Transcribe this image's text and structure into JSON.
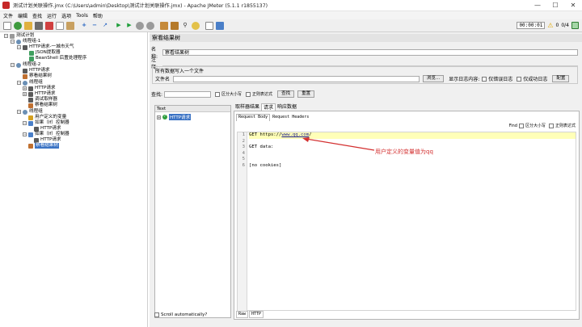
{
  "window": {
    "title": "测试计划关联操作.jmx (C:\\Users\\admin\\Desktop\\测试计划关联操作.jmx) - Apache JMeter (5.1.1 r1855137)",
    "controls": [
      "—",
      "☐",
      "✕"
    ]
  },
  "menu": [
    "文件",
    "编辑",
    "查找",
    "运行",
    "选项",
    "Tools",
    "帮助"
  ],
  "toolbar": {
    "timer": "00:00:01",
    "warn_count": "0",
    "threads": "0/4"
  },
  "tree": [
    {
      "label": "测试计划",
      "exp": "−"
    },
    {
      "label": "线程组-1",
      "exp": "−"
    },
    {
      "label": "HTTP请求-一城市天气",
      "exp": "−"
    },
    {
      "label": "JSON提取器",
      "exp": ""
    },
    {
      "label": "BeanShell 后置处理程序",
      "exp": ""
    },
    {
      "label": "线程组-2",
      "exp": "−"
    },
    {
      "label": "HTTP请求",
      "exp": ""
    },
    {
      "label": "察看结果树",
      "exp": ""
    },
    {
      "label": "线程组",
      "exp": "−"
    },
    {
      "label": "HTTP请求",
      "exp": ""
    },
    {
      "label": "HTTP请求",
      "exp": ""
    },
    {
      "label": "调试取样器",
      "exp": ""
    },
    {
      "label": "察看结果树",
      "exp": ""
    },
    {
      "label": "线程组",
      "exp": "−"
    },
    {
      "label": "用户定义的变量",
      "exp": ""
    },
    {
      "label": "如果（If）控制器",
      "exp": "−"
    },
    {
      "label": "HTTP请求",
      "exp": ""
    },
    {
      "label": "如果（If）控制器",
      "exp": "−"
    },
    {
      "label": "HTTP请求",
      "exp": ""
    },
    {
      "label": "察看结果树",
      "exp": "",
      "selected": true
    }
  ],
  "panel": {
    "title": "察看结果树",
    "name_label": "名称:",
    "name_value": "察看结果树",
    "comment_label": "注释:",
    "all_data_label": "所有数据写入一个文件",
    "filename_label": "文件名",
    "browse_btn": "浏览...",
    "log_label": "显示日志内容:",
    "errors_only": "仅错误日志",
    "success_only": "仅成功日志",
    "configure_btn": "配置",
    "search_label": "查找:",
    "case_sensitive": "区分大小写",
    "regex": "正则表达式",
    "find_btn": "查找",
    "reset_btn": "重置"
  },
  "results": {
    "header": "Text",
    "item": "HTTP请求",
    "scroll_auto": "Scroll automatically?"
  },
  "view": {
    "tabs": [
      "取样器结果",
      "请求",
      "响应数据"
    ],
    "active_tab": 1,
    "subtabs": [
      "Request Body",
      "Request Headers"
    ],
    "find_label": "Find",
    "find_case": "区分大小写",
    "find_regex": "正则表达式",
    "code_lines": [
      {
        "n": "1",
        "pre": "GET https://",
        "url": "www.qq.com",
        "post": "/"
      },
      {
        "n": "2",
        "pre": "",
        "url": "",
        "post": ""
      },
      {
        "n": "3",
        "pre": "GET data:",
        "url": "",
        "post": ""
      },
      {
        "n": "4",
        "pre": "",
        "url": "",
        "post": ""
      },
      {
        "n": "5",
        "pre": "",
        "url": "",
        "post": ""
      },
      {
        "n": "6",
        "pre": "[no cookies]",
        "url": "",
        "post": ""
      }
    ],
    "bottom_tabs": [
      "Raw",
      "HTTP"
    ]
  },
  "annotation": {
    "text": "用户定义的变量值为qq",
    "color": "#d32f2f"
  }
}
